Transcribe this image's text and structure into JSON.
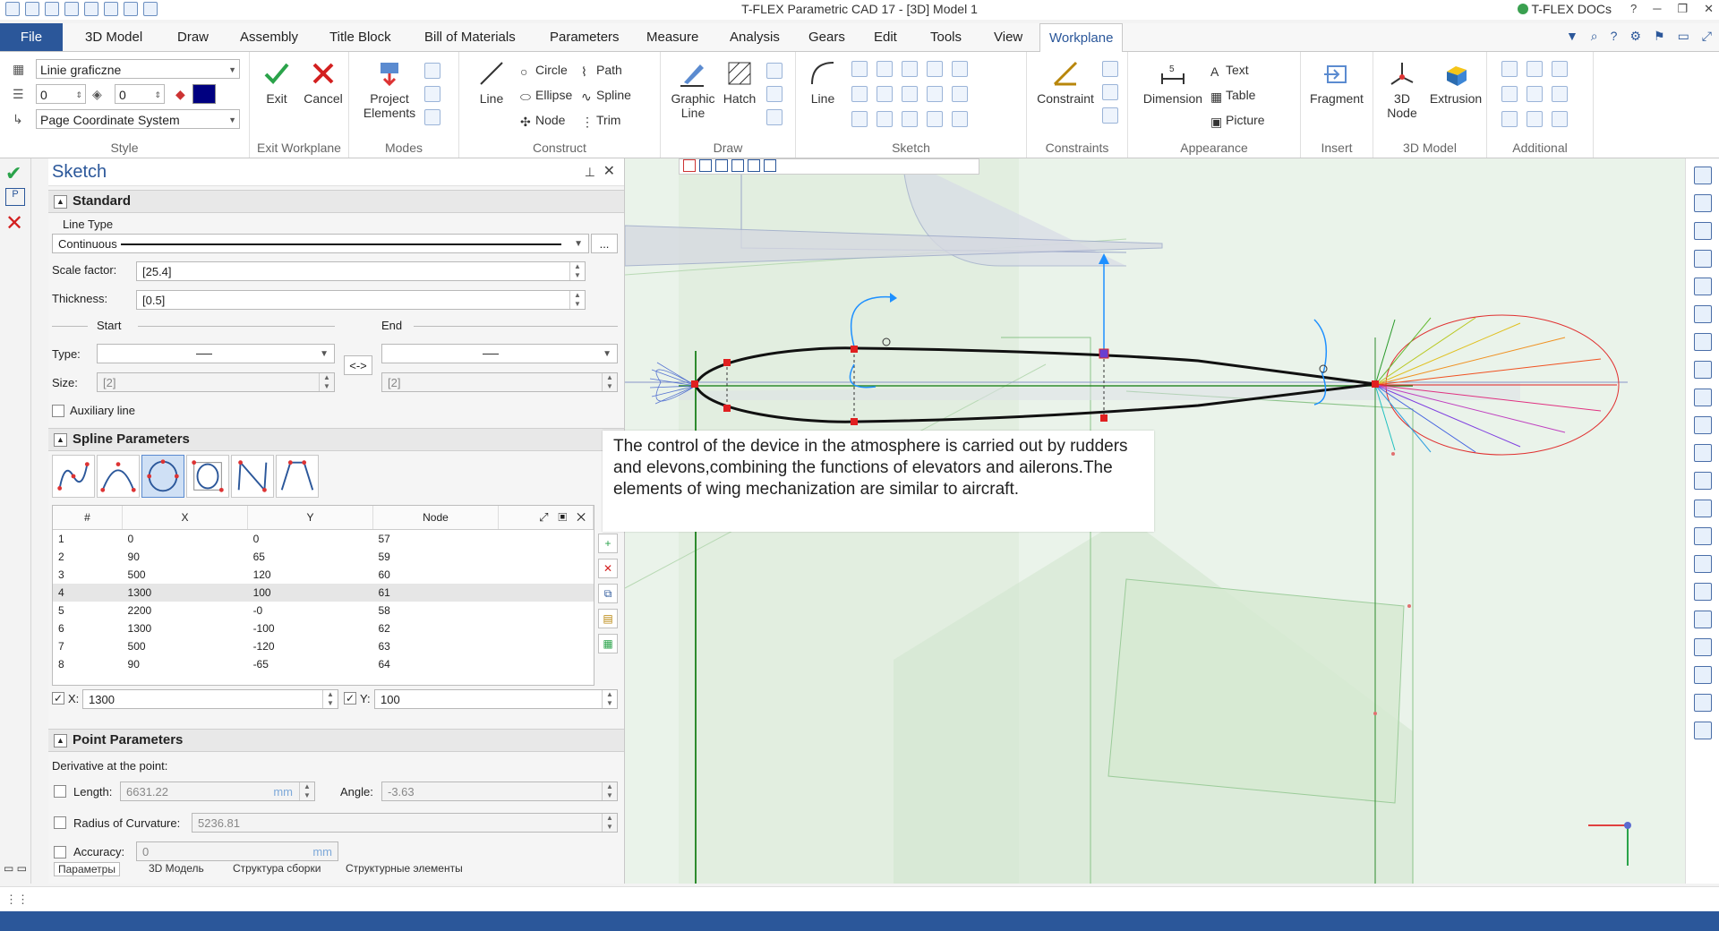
{
  "window": {
    "title": "T-FLEX Parametric CAD 17 - [3D] Model 1",
    "docs_label": "T-FLEX DOCs",
    "help": "?"
  },
  "menu_tabs": [
    "File",
    "3D Model",
    "Draw",
    "Assembly",
    "Title Block",
    "Bill of Materials",
    "Parameters",
    "Measure",
    "Analysis",
    "Gears",
    "Edit",
    "Tools",
    "View",
    "Workplane"
  ],
  "ribbon": {
    "style": {
      "layer": "Linie graficzne",
      "level": "0",
      "priority": "0",
      "coordinate_system": "Page Coordinate System",
      "color": "#000080",
      "label": "Style"
    },
    "exit_workplane": {
      "exit": "Exit",
      "cancel": "Cancel",
      "label": "Exit Workplane"
    },
    "modes": {
      "project": "Project Elements",
      "label": "Modes"
    },
    "construct": {
      "line": "Line",
      "circle": "Circle",
      "ellipse": "Ellipse",
      "node": "Node",
      "path": "Path",
      "spline": "Spline",
      "trim": "Trim",
      "label": "Construct"
    },
    "draw": {
      "graphic_line": "Graphic Line",
      "hatch": "Hatch",
      "label": "Draw"
    },
    "sketch": {
      "line": "Line",
      "label": "Sketch"
    },
    "constraints": {
      "constraint": "Constraint",
      "label": "Constraints"
    },
    "appearance": {
      "dimension": "Dimension",
      "text": "Text",
      "table": "Table",
      "picture": "Picture",
      "label": "Appearance"
    },
    "insert": {
      "fragment": "Fragment",
      "label": "Insert"
    },
    "model3d": {
      "node": "3D Node",
      "extrusion": "Extrusion",
      "label": "3D Model"
    },
    "additional": {
      "label": "Additional"
    }
  },
  "panel": {
    "title": "Sketch",
    "standard": {
      "header": "Standard",
      "line_type_label": "Line Type",
      "line_type": "Continuous",
      "more": "...",
      "scale_label": "Scale factor:",
      "scale": "[25.4]",
      "thickness_label": "Thickness:",
      "thickness": "[0.5]",
      "start_label": "Start",
      "end_label": "End",
      "type_label": "Type:",
      "size_label": "Size:",
      "start_size": "[2]",
      "end_size": "[2]",
      "swap": "<->",
      "aux_label": "Auxiliary line"
    },
    "spline": {
      "header": "Spline Parameters",
      "columns": [
        "#",
        "X",
        "Y",
        "Node"
      ],
      "rows": [
        [
          "1",
          "0",
          "0",
          "57"
        ],
        [
          "2",
          "90",
          "65",
          "59"
        ],
        [
          "3",
          "500",
          "120",
          "60"
        ],
        [
          "4",
          "1300",
          "100",
          "61"
        ],
        [
          "5",
          "2200",
          "-0",
          "58"
        ],
        [
          "6",
          "1300",
          "-100",
          "62"
        ],
        [
          "7",
          "500",
          "-120",
          "63"
        ],
        [
          "8",
          "90",
          "-65",
          "64"
        ]
      ],
      "x_label": "X:",
      "x_value": "1300",
      "y_label": "Y:",
      "y_value": "100"
    },
    "point": {
      "header": "Point Parameters",
      "derivative_label": "Derivative at the point:",
      "length_label": "Length:",
      "length": "6631.22",
      "length_unit": "mm",
      "angle_label": "Angle:",
      "angle": "-3.63",
      "radius_label": "Radius of Curvature:",
      "radius": "5236.81",
      "accuracy_label": "Accuracy:",
      "accuracy": "0",
      "accuracy_unit": "mm"
    },
    "bottom_tabs": [
      "Параметры",
      "3D Модель",
      "Структура сборки",
      "Структурные элементы"
    ]
  },
  "tooltip": "The control of the device in the atmosphere is carried out by rudders and elevons,combining the functions of elevators and ailerons.The elements of wing mechanization are similar to aircraft."
}
